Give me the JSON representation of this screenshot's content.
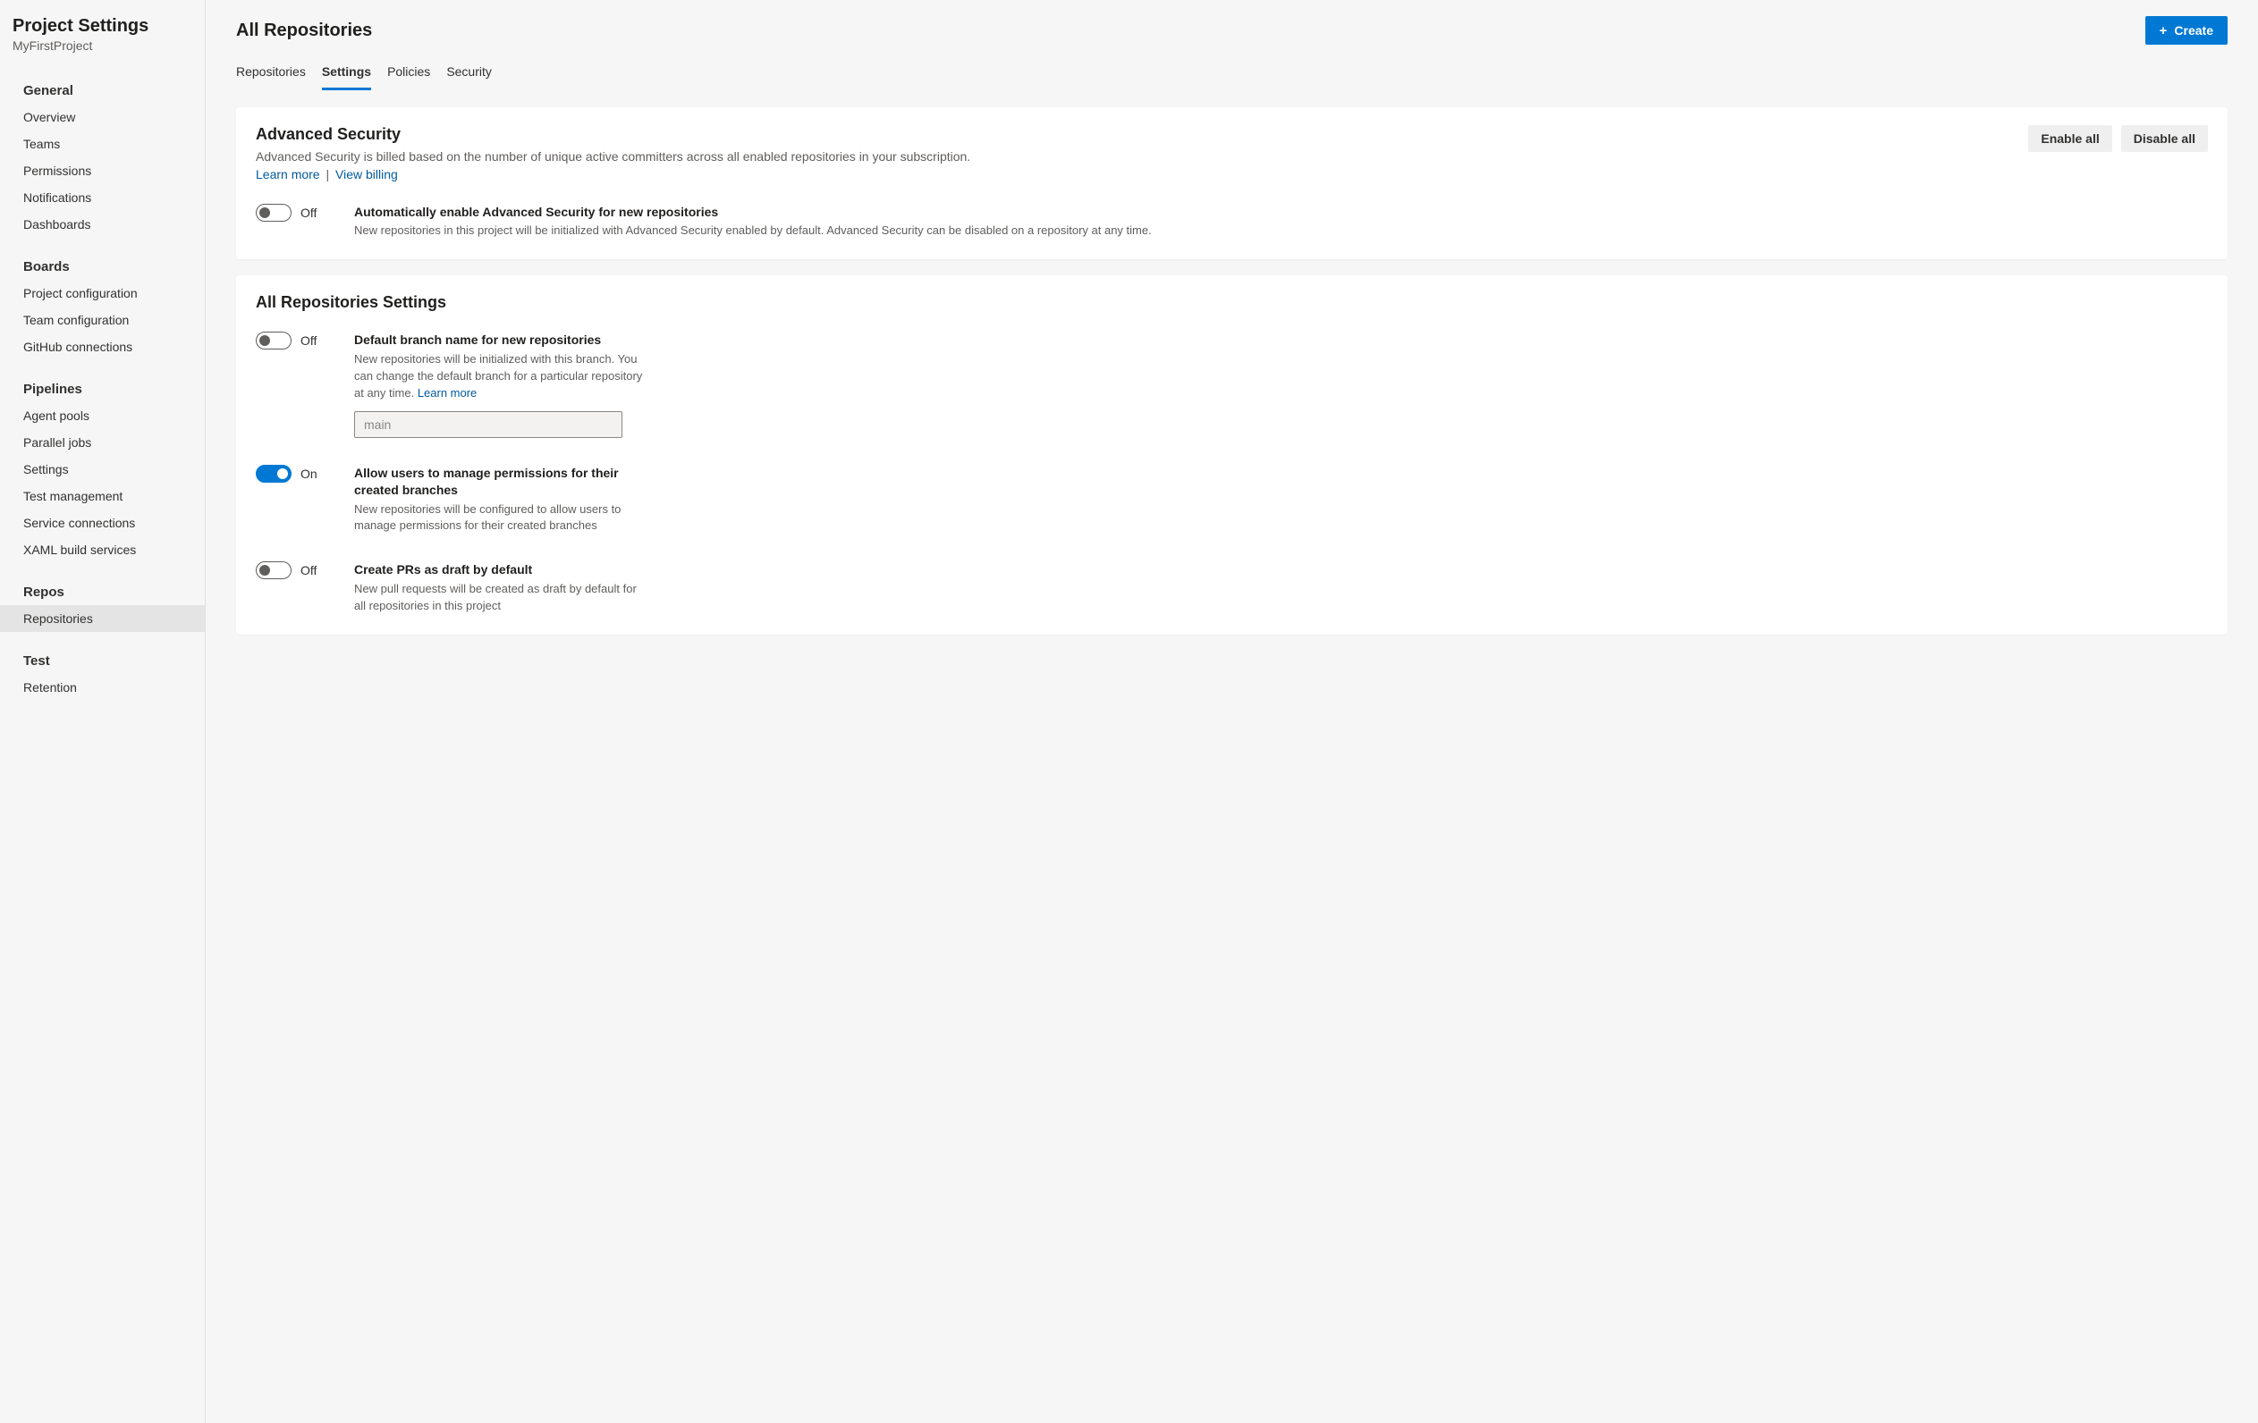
{
  "sidebar": {
    "title": "Project Settings",
    "subtitle": "MyFirstProject",
    "groups": [
      {
        "label": "General",
        "items": [
          {
            "label": "Overview",
            "active": false
          },
          {
            "label": "Teams",
            "active": false
          },
          {
            "label": "Permissions",
            "active": false
          },
          {
            "label": "Notifications",
            "active": false
          },
          {
            "label": "Dashboards",
            "active": false
          }
        ]
      },
      {
        "label": "Boards",
        "items": [
          {
            "label": "Project configuration",
            "active": false
          },
          {
            "label": "Team configuration",
            "active": false
          },
          {
            "label": "GitHub connections",
            "active": false
          }
        ]
      },
      {
        "label": "Pipelines",
        "items": [
          {
            "label": "Agent pools",
            "active": false
          },
          {
            "label": "Parallel jobs",
            "active": false
          },
          {
            "label": "Settings",
            "active": false
          },
          {
            "label": "Test management",
            "active": false
          },
          {
            "label": "Service connections",
            "active": false
          },
          {
            "label": "XAML build services",
            "active": false
          }
        ]
      },
      {
        "label": "Repos",
        "items": [
          {
            "label": "Repositories",
            "active": true
          }
        ]
      },
      {
        "label": "Test",
        "items": [
          {
            "label": "Retention",
            "active": false
          }
        ]
      }
    ]
  },
  "header": {
    "title": "All Repositories",
    "create_label": "Create"
  },
  "tabs": [
    {
      "label": "Repositories",
      "active": false
    },
    {
      "label": "Settings",
      "active": true
    },
    {
      "label": "Policies",
      "active": false
    },
    {
      "label": "Security",
      "active": false
    }
  ],
  "advanced_security": {
    "title": "Advanced Security",
    "description": "Advanced Security is billed based on the number of unique active committers across all enabled repositories in your subscription.",
    "learn_more": "Learn more",
    "sep": "|",
    "view_billing": "View billing",
    "enable_all": "Enable all",
    "disable_all": "Disable all",
    "auto_enable": {
      "on": false,
      "state_label": "Off",
      "title": "Automatically enable Advanced Security for new repositories",
      "desc": "New repositories in this project will be initialized with Advanced Security enabled by default. Advanced Security can be disabled on a repository at any time."
    }
  },
  "repo_settings": {
    "title": "All Repositories Settings",
    "items": [
      {
        "on": false,
        "state_label": "Off",
        "title": "Default branch name for new repositories",
        "desc": "New repositories will be initialized with this branch. You can change the default branch for a particular repository at any time. ",
        "link": "Learn more",
        "input_value": "",
        "input_placeholder": "main",
        "has_input": true
      },
      {
        "on": true,
        "state_label": "On",
        "title": "Allow users to manage permissions for their created branches",
        "desc": "New repositories will be configured to allow users to manage permissions for their created branches",
        "has_input": false
      },
      {
        "on": false,
        "state_label": "Off",
        "title": "Create PRs as draft by default",
        "desc": "New pull requests will be created as draft by default for all repositories in this project",
        "has_input": false
      }
    ]
  }
}
